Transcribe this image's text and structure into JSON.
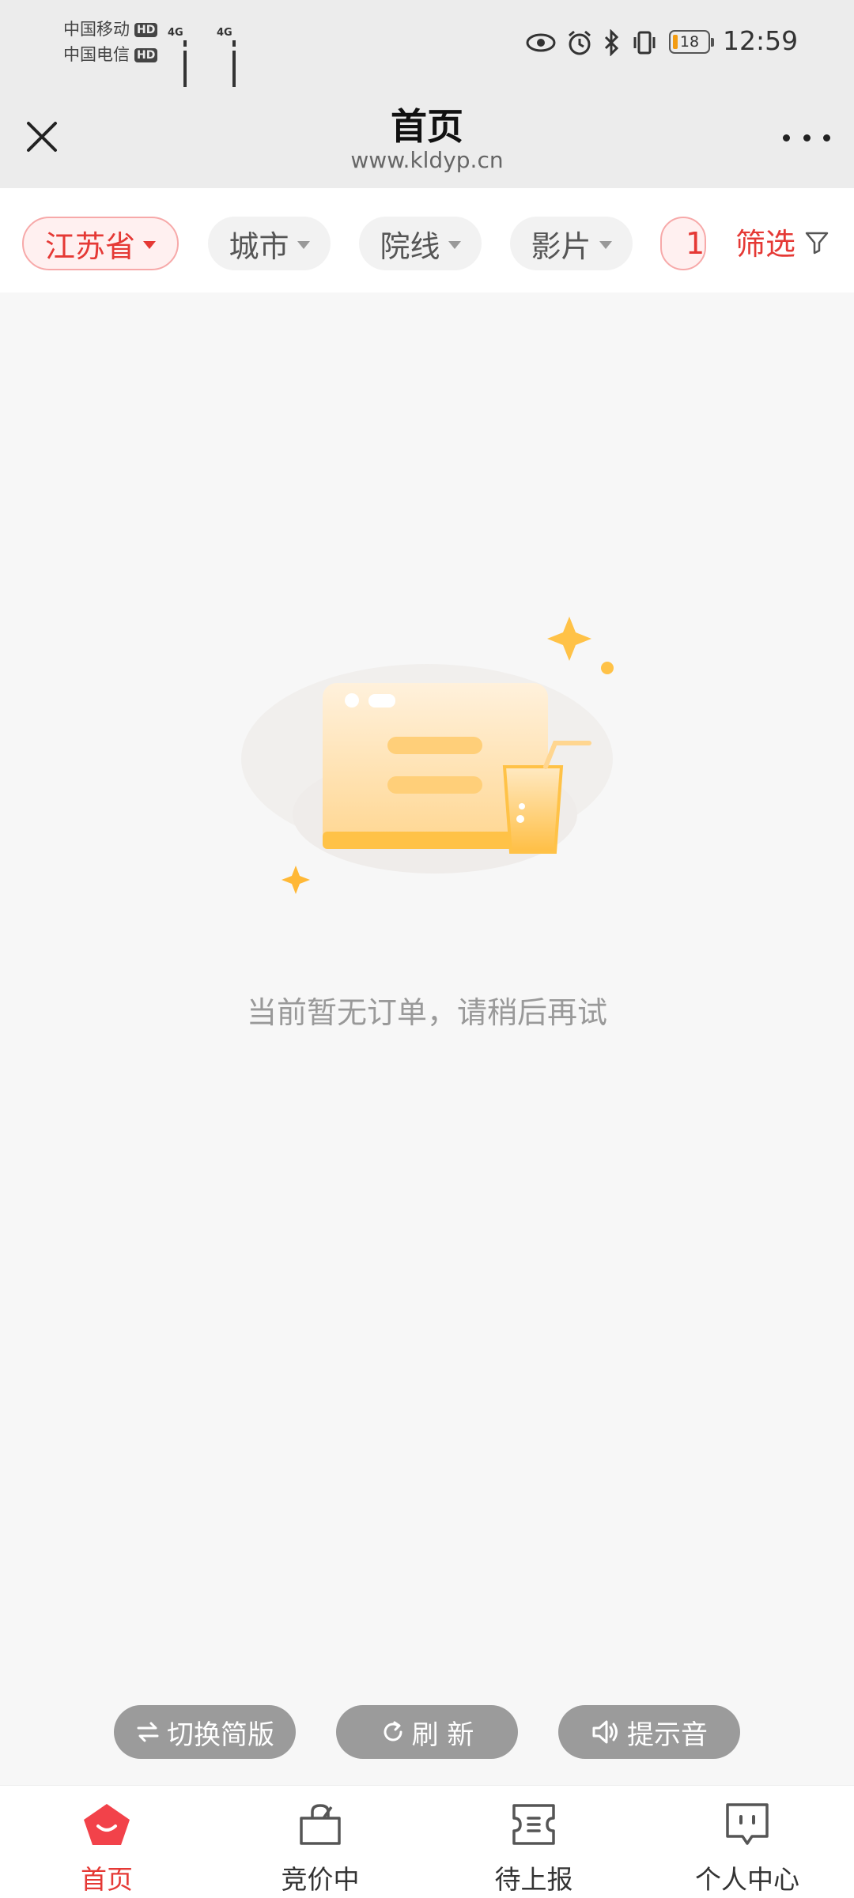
{
  "status_bar": {
    "carrier1": "中国移动",
    "carrier2": "中国电信",
    "hd": "HD",
    "net1": "4G",
    "net2": "4G",
    "battery": "18",
    "time": "12:59",
    "battery_color": "#f39c12"
  },
  "header": {
    "title": "首页",
    "url": "www.kldyp.cn"
  },
  "filters": {
    "chips": [
      {
        "label": "江苏省",
        "active": true
      },
      {
        "label": "城市",
        "active": false
      },
      {
        "label": "院线",
        "active": false
      },
      {
        "label": "影片",
        "active": false
      },
      {
        "label": "1",
        "active": true
      }
    ],
    "filter_label": "筛选"
  },
  "empty_state": {
    "message": "当前暂无订单，请稍后再试"
  },
  "actions": {
    "switch_label": "切换简版",
    "refresh_label": "刷 新",
    "sound_label": "提示音"
  },
  "tabs": [
    {
      "label": "首页",
      "icon": "home-icon",
      "active": true
    },
    {
      "label": "竞价中",
      "icon": "shopping-bag-icon",
      "active": false
    },
    {
      "label": "待上报",
      "icon": "ticket-icon",
      "active": false
    },
    {
      "label": "个人中心",
      "icon": "user-chat-icon",
      "active": false
    }
  ],
  "colors": {
    "accent": "#e53935",
    "illustration": "#ffc247"
  }
}
